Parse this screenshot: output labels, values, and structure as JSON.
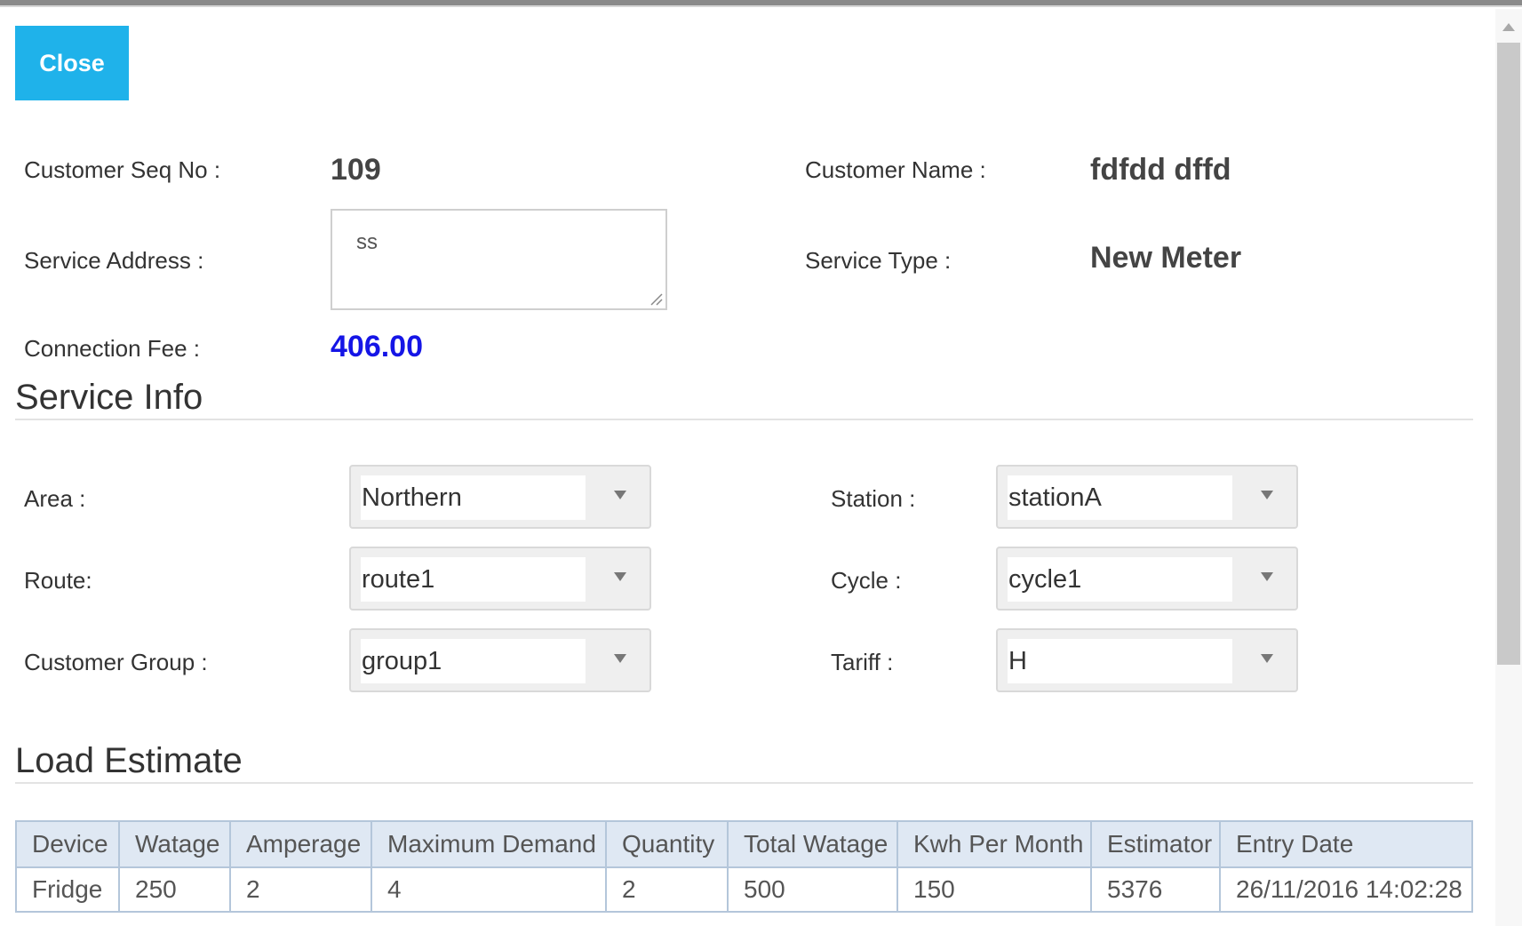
{
  "close_label": "Close",
  "customer": {
    "seq_label": "Customer Seq No :",
    "seq_value": "109",
    "name_label": "Customer Name :",
    "name_value": "fdfdd dffd",
    "address_label": "Service Address :",
    "address_value": "ss",
    "type_label": "Service Type :",
    "type_value": "New Meter",
    "fee_label": "Connection Fee :",
    "fee_value": "406.00"
  },
  "service_info": {
    "title": "Service Info",
    "area_label": "Area :",
    "area_value": "Northern",
    "station_label": "Station :",
    "station_value": "stationA",
    "route_label": "Route:",
    "route_value": "route1",
    "cycle_label": "Cycle :",
    "cycle_value": "cycle1",
    "group_label": "Customer Group :",
    "group_value": "group1",
    "tariff_label": "Tariff :",
    "tariff_value": "H"
  },
  "load_estimate": {
    "title": "Load Estimate",
    "columns": [
      "Device",
      "Watage",
      "Amperage",
      "Maximum Demand",
      "Quantity",
      "Total Watage",
      "Kwh Per Month",
      "Estimator",
      "Entry Date"
    ],
    "rows": [
      [
        "Fridge",
        "250",
        "2",
        "4",
        "2",
        "500",
        "150",
        "5376",
        "26/11/2016 14:02:28"
      ]
    ]
  },
  "colors": {
    "close_button": "#1fb2ea",
    "fee_value": "#1515e6",
    "table_header_bg": "#dfe8f3"
  }
}
